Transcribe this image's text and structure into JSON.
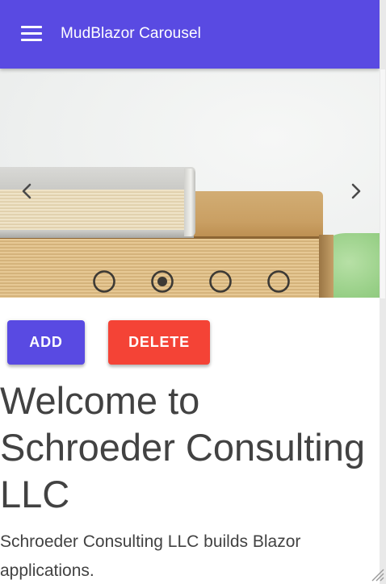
{
  "appbar": {
    "title": "MudBlazor Carousel",
    "background": "#594ae2",
    "menu_icon": "hamburger-menu-icon"
  },
  "carousel": {
    "slide_count": 4,
    "active_index": 1,
    "prev_icon": "chevron-left-icon",
    "next_icon": "chevron-right-icon",
    "bullet_icon": "radio-circle-icon"
  },
  "actions": {
    "add_label": "ADD",
    "delete_label": "DELETE",
    "add_color": "#594ae2",
    "delete_color": "#f44336"
  },
  "content": {
    "headline": "Welcome to Schroeder Consulting LLC",
    "body": "Schroeder Consulting LLC builds Blazor applications."
  }
}
